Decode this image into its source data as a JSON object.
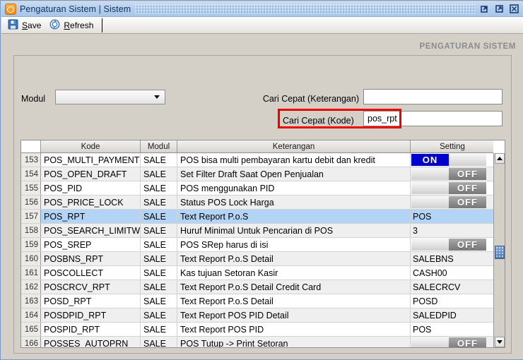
{
  "window": {
    "title": "Pengaturan Sistem | Sistem",
    "app_icon": "app-logo-icon",
    "buttons": [
      {
        "name": "restore-button",
        "icon": "restore-icon"
      },
      {
        "name": "maximize-button",
        "icon": "maximize-icon"
      },
      {
        "name": "close-button",
        "icon": "close-icon"
      }
    ]
  },
  "toolbar": {
    "save_label": "Save",
    "save_accel": "S",
    "save_icon": "floppy-disk-icon",
    "refresh_label": "Refresh",
    "refresh_accel": "R",
    "refresh_icon": "refresh-circle-icon"
  },
  "page": {
    "heading": "PENGATURAN SISTEM"
  },
  "filters": {
    "modul_label": "Modul",
    "modul_value": "",
    "modul_placeholder": "",
    "cari_keterangan_label": "Cari Cepat (Keterangan)",
    "cari_keterangan_value": "",
    "cari_kode_label": "Cari Cepat (Kode)",
    "cari_kode_value": "pos_rpt",
    "highlight_color": "#ee0000"
  },
  "grid": {
    "columns": [
      {
        "key": "num",
        "label": ""
      },
      {
        "key": "kode",
        "label": "Kode"
      },
      {
        "key": "modul",
        "label": "Modul"
      },
      {
        "key": "ket",
        "label": "Keterangan"
      },
      {
        "key": "set",
        "label": "Setting"
      }
    ],
    "toggle_on_label": "ON",
    "toggle_off_label": "OFF",
    "rows": [
      {
        "num": "153",
        "kode": "POS_MULTI_PAYMENT",
        "modul": "SALE",
        "ket": "POS bisa multi pembayaran kartu debit dan kredit",
        "type": "toggle",
        "set": "ON",
        "selected": false
      },
      {
        "num": "154",
        "kode": "POS_OPEN_DRAFT",
        "modul": "SALE",
        "ket": "Set Filter Draft Saat Open Penjualan",
        "type": "toggle",
        "set": "OFF",
        "selected": false
      },
      {
        "num": "155",
        "kode": "POS_PID",
        "modul": "SALE",
        "ket": "POS menggunakan PID",
        "type": "toggle",
        "set": "OFF",
        "selected": false
      },
      {
        "num": "156",
        "kode": "POS_PRICE_LOCK",
        "modul": "SALE",
        "ket": "Status POS Lock Harga",
        "type": "toggle",
        "set": "OFF",
        "selected": false
      },
      {
        "num": "157",
        "kode": "POS_RPT",
        "modul": "SALE",
        "ket": "Text Report P.o.S",
        "type": "text",
        "set": "POS",
        "selected": true
      },
      {
        "num": "158",
        "kode": "POS_SEARCH_LIMITW",
        "modul": "SALE",
        "ket": "Huruf Minimal Untuk Pencarian di POS",
        "type": "text",
        "set": "3",
        "selected": false
      },
      {
        "num": "159",
        "kode": "POS_SREP",
        "modul": "SALE",
        "ket": "POS SRep harus di isi",
        "type": "toggle",
        "set": "OFF",
        "selected": false
      },
      {
        "num": "160",
        "kode": "POSBNS_RPT",
        "modul": "SALE",
        "ket": "Text Report P.o.S Detail",
        "type": "text",
        "set": "SALEBNS",
        "selected": false
      },
      {
        "num": "161",
        "kode": "POSCOLLECT",
        "modul": "SALE",
        "ket": "Kas tujuan Setoran Kasir",
        "type": "text",
        "set": "CASH00",
        "selected": false
      },
      {
        "num": "162",
        "kode": "POSCRCV_RPT",
        "modul": "SALE",
        "ket": "Text Report P.o.S Detail Credit Card",
        "type": "text",
        "set": "SALECRCV",
        "selected": false
      },
      {
        "num": "163",
        "kode": "POSD_RPT",
        "modul": "SALE",
        "ket": "Text Report P.o.S Detail",
        "type": "text",
        "set": "POSD",
        "selected": false
      },
      {
        "num": "164",
        "kode": "POSDPID_RPT",
        "modul": "SALE",
        "ket": "Text Report POS PID Detail",
        "type": "text",
        "set": "SALEDPID",
        "selected": false
      },
      {
        "num": "165",
        "kode": "POSPID_RPT",
        "modul": "SALE",
        "ket": "Text Report POS PID",
        "type": "text",
        "set": "POS",
        "selected": false
      },
      {
        "num": "166",
        "kode": "POSSES_AUTOPRN",
        "modul": "SALE",
        "ket": "POS Tutup -> Print Setoran",
        "type": "toggle",
        "set": "OFF",
        "selected": false
      }
    ]
  }
}
